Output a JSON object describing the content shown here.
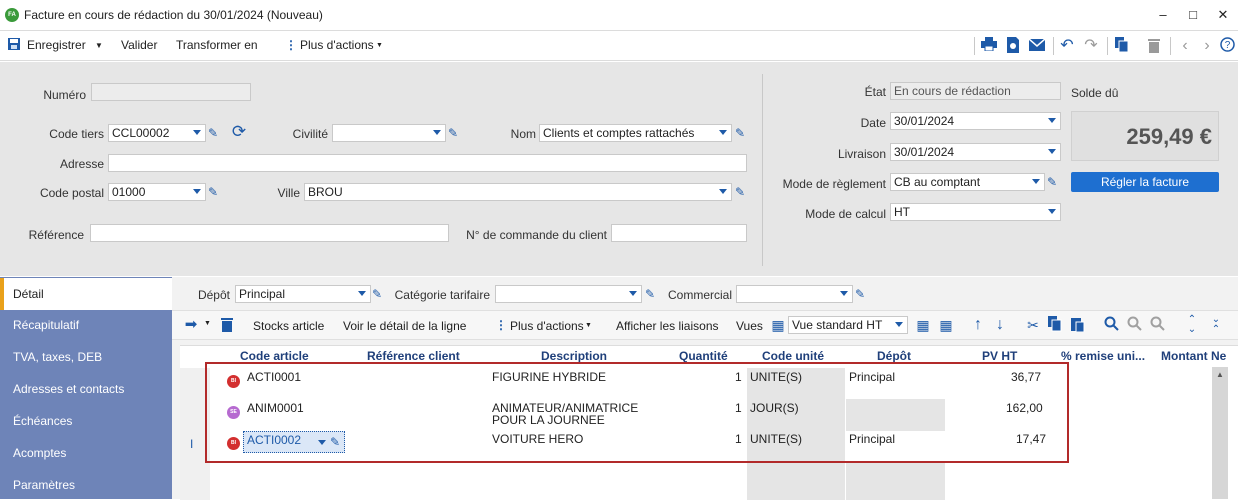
{
  "window": {
    "app_icon": "FA",
    "title": "Facture en cours de rédaction du 30/01/2024 (Nouveau)",
    "minimize": "–",
    "maximize": "□",
    "close": "✕"
  },
  "toolbar": {
    "save": "Enregistrer",
    "validate": "Valider",
    "transform": "Transformer en",
    "more": "Plus d'actions"
  },
  "header": {
    "numero_label": "Numéro",
    "numero_value": "",
    "code_tiers_label": "Code tiers",
    "code_tiers_value": "CCL00002",
    "civilite_label": "Civilité",
    "civilite_value": "",
    "nom_label": "Nom",
    "nom_value": "Clients et comptes rattachés",
    "adresse_label": "Adresse",
    "adresse_value": "",
    "code_postal_label": "Code postal",
    "code_postal_value": "01000",
    "ville_label": "Ville",
    "ville_value": "BROU",
    "reference_label": "Référence",
    "reference_value": "",
    "commande_label": "N° de commande du client",
    "commande_value": "",
    "etat_label": "État",
    "etat_value": "En cours de rédaction",
    "date_label": "Date",
    "date_value": "30/01/2024",
    "livraison_label": "Livraison",
    "livraison_value": "30/01/2024",
    "reglement_label": "Mode de règlement",
    "reglement_value": "CB au comptant",
    "calcul_label": "Mode de calcul",
    "calcul_value": "HT",
    "solde_label": "Solde dû",
    "solde_value": "259,49 €",
    "regler_button": "Régler la facture"
  },
  "sidebar": {
    "items": [
      {
        "label": "Détail"
      },
      {
        "label": "Récapitulatif"
      },
      {
        "label": "TVA, taxes, DEB"
      },
      {
        "label": "Adresses et contacts"
      },
      {
        "label": "Échéances"
      },
      {
        "label": "Acomptes"
      },
      {
        "label": "Paramètres"
      }
    ]
  },
  "detail": {
    "depot_label": "Dépôt",
    "depot_value": "Principal",
    "categorie_label": "Catégorie tarifaire",
    "categorie_value": "",
    "commercial_label": "Commercial",
    "commercial_value": "",
    "stocks": "Stocks article",
    "voir_detail": "Voir le détail de la ligne",
    "plus_actions": "Plus d'actions",
    "afficher_liaisons": "Afficher les liaisons",
    "vues_label": "Vues",
    "vue_value": "Vue standard HT"
  },
  "grid": {
    "columns": [
      "Code article",
      "Référence client",
      "Description",
      "Quantité",
      "Code unité",
      "Dépôt",
      "PV HT",
      "% remise uni...",
      "Montant Ne"
    ],
    "rows": [
      {
        "badge": "BI",
        "code": "ACTI0001",
        "ref": "",
        "desc1": "FIGURINE HYBRIDE",
        "desc2": "",
        "qty": "1",
        "unit": "UNITE(S)",
        "depot": "Principal",
        "pv": "36,77"
      },
      {
        "badge": "SE",
        "code": "ANIM0001",
        "ref": "",
        "desc1": "ANIMATEUR/ANIMATRICE",
        "desc2": "POUR LA JOURNEE",
        "qty": "1",
        "unit": "JOUR(S)",
        "depot": "",
        "pv": "162,00"
      },
      {
        "badge": "BI",
        "code": "ACTI0002",
        "ref": "",
        "desc1": "VOITURE HERO",
        "desc2": "",
        "qty": "1",
        "unit": "UNITE(S)",
        "depot": "Principal",
        "pv": "17,47"
      }
    ],
    "cursor_mark": "I"
  },
  "colors": {
    "accent": "#1e6fd0",
    "sidebar": "#6e84b8",
    "highlight": "#b22a2a",
    "badge_bi": "#d32f2f",
    "badge_se": "#b66ad0"
  }
}
